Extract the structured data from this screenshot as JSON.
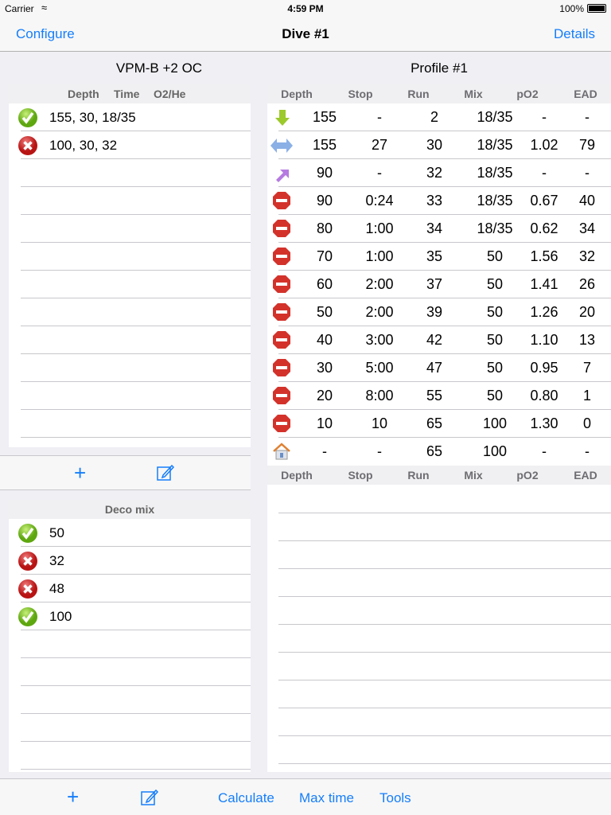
{
  "status": {
    "carrier": "Carrier",
    "time": "4:59 PM",
    "battery": "100%"
  },
  "nav": {
    "left": "Configure",
    "title": "Dive #1",
    "right": "Details"
  },
  "left": {
    "title": "VPM-B  +2  OC",
    "headers": [
      "Depth",
      "Time",
      "O2/He"
    ],
    "levels": [
      {
        "icon": "check",
        "text": "155, 30, 18/35"
      },
      {
        "icon": "cross",
        "text": "100, 30, 32"
      }
    ],
    "deco_header": "Deco mix",
    "deco": [
      {
        "icon": "check",
        "text": "50"
      },
      {
        "icon": "cross",
        "text": "32"
      },
      {
        "icon": "cross",
        "text": "48"
      },
      {
        "icon": "check",
        "text": "100"
      }
    ]
  },
  "profile": {
    "title": "Profile #1",
    "headers": [
      "Depth",
      "Stop",
      "Run",
      "Mix",
      "pO2",
      "EAD"
    ],
    "rows": [
      {
        "icon": "descend",
        "cells": [
          "155",
          "-",
          "2",
          "18/35",
          "-",
          "-"
        ]
      },
      {
        "icon": "level",
        "cells": [
          "155",
          "27",
          "30",
          "18/35",
          "1.02",
          "79"
        ]
      },
      {
        "icon": "ascend",
        "cells": [
          "90",
          "-",
          "32",
          "18/35",
          "-",
          "-"
        ]
      },
      {
        "icon": "stop",
        "cells": [
          "90",
          "0:24",
          "33",
          "18/35",
          "0.67",
          "40"
        ]
      },
      {
        "icon": "stop",
        "cells": [
          "80",
          "1:00",
          "34",
          "18/35",
          "0.62",
          "34"
        ]
      },
      {
        "icon": "stop",
        "cells": [
          "70",
          "1:00",
          "35",
          "50",
          "1.56",
          "32"
        ]
      },
      {
        "icon": "stop",
        "cells": [
          "60",
          "2:00",
          "37",
          "50",
          "1.41",
          "26"
        ]
      },
      {
        "icon": "stop",
        "cells": [
          "50",
          "2:00",
          "39",
          "50",
          "1.26",
          "20"
        ]
      },
      {
        "icon": "stop",
        "cells": [
          "40",
          "3:00",
          "42",
          "50",
          "1.10",
          "13"
        ]
      },
      {
        "icon": "stop",
        "cells": [
          "30",
          "5:00",
          "47",
          "50",
          "0.95",
          "7"
        ]
      },
      {
        "icon": "stop",
        "cells": [
          "20",
          "8:00",
          "55",
          "50",
          "0.80",
          "1"
        ]
      },
      {
        "icon": "stop",
        "cells": [
          "10",
          "10",
          "65",
          "100",
          "1.30",
          "0"
        ]
      },
      {
        "icon": "home",
        "cells": [
          "-",
          "-",
          "65",
          "100",
          "-",
          "-"
        ]
      }
    ]
  },
  "toolbar": {
    "calculate": "Calculate",
    "max_time": "Max time",
    "tools": "Tools"
  },
  "colors": {
    "accent": "#157efb"
  }
}
